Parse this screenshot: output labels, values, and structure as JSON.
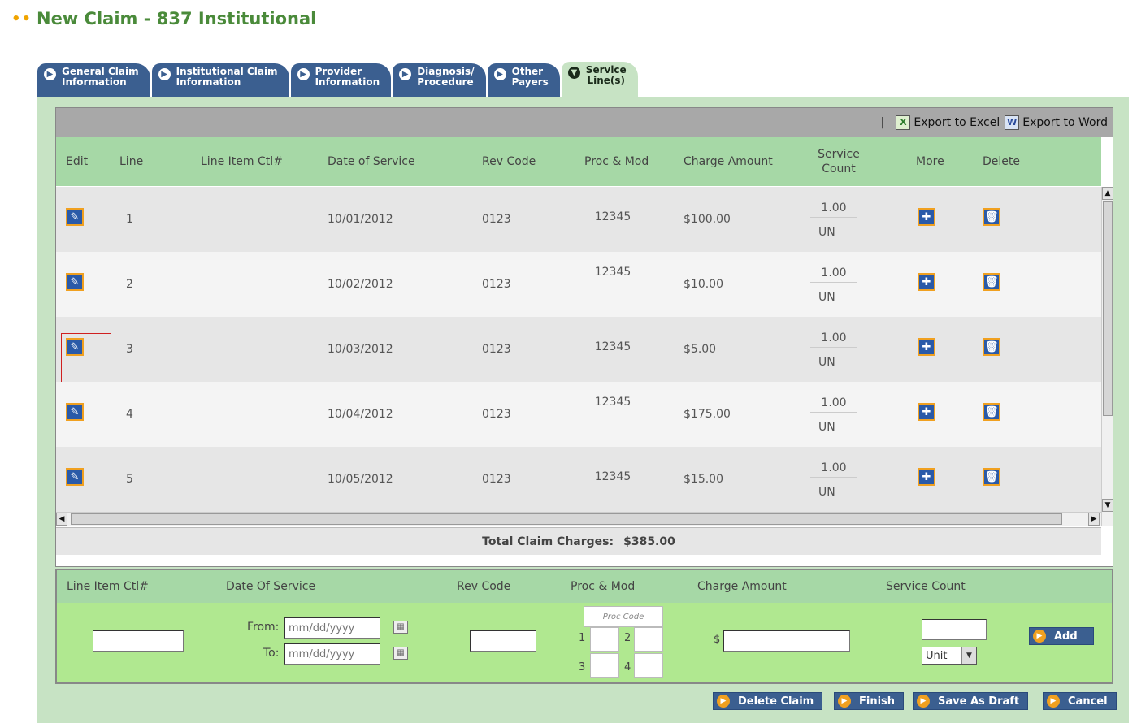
{
  "page": {
    "title": "New Claim - 837 Institutional"
  },
  "tabs": [
    {
      "label": "General Claim\nInformation",
      "active": false
    },
    {
      "label": "Institutional Claim\nInformation",
      "active": false
    },
    {
      "label": "Provider\nInformation",
      "active": false
    },
    {
      "label": "Diagnosis/\nProcedure",
      "active": false
    },
    {
      "label": "Other\nPayers",
      "active": false
    },
    {
      "label": "Service\nLine(s)",
      "active": true
    }
  ],
  "toolbar": {
    "separator": "|",
    "export_excel": "Export to Excel",
    "export_word": "Export to Word"
  },
  "grid": {
    "columns": {
      "edit": "Edit",
      "line": "Line",
      "ctl": "Line Item Ctl#",
      "date": "Date of Service",
      "rev": "Rev Code",
      "proc": "Proc & Mod",
      "charge": "Charge Amount",
      "count": "Service Count",
      "more": "More",
      "delete": "Delete"
    },
    "rows": [
      {
        "line": "1",
        "ctl": "",
        "date": "10/01/2012",
        "rev": "0123",
        "proc": "12345",
        "charge": "$100.00",
        "count": "1.00",
        "unit": "UN"
      },
      {
        "line": "2",
        "ctl": "",
        "date": "10/02/2012",
        "rev": "0123",
        "proc": "12345",
        "charge": "$10.00",
        "count": "1.00",
        "unit": "UN"
      },
      {
        "line": "3",
        "ctl": "",
        "date": "10/03/2012",
        "rev": "0123",
        "proc": "12345",
        "charge": "$5.00",
        "count": "1.00",
        "unit": "UN"
      },
      {
        "line": "4",
        "ctl": "",
        "date": "10/04/2012",
        "rev": "0123",
        "proc": "12345",
        "charge": "$175.00",
        "count": "1.00",
        "unit": "UN"
      },
      {
        "line": "5",
        "ctl": "",
        "date": "10/05/2012",
        "rev": "0123",
        "proc": "12345",
        "charge": "$15.00",
        "count": "1.00",
        "unit": "UN"
      }
    ],
    "total_label": "Total Claim Charges:",
    "total_value": "$385.00"
  },
  "entry": {
    "columns": {
      "ctl": "Line Item Ctl#",
      "date": "Date Of Service",
      "rev": "Rev Code",
      "proc": "Proc & Mod",
      "charge": "Charge Amount",
      "count": "Service Count"
    },
    "from_label": "From:",
    "to_label": "To:",
    "date_placeholder": "mm/dd/yyyy",
    "proc_placeholder": "Proc Code",
    "mod_labels": [
      "1",
      "2",
      "3",
      "4"
    ],
    "dollar": "$",
    "unit_selected": "Unit",
    "add_label": "Add"
  },
  "actions": {
    "delete_claim": "Delete Claim",
    "finish": "Finish",
    "save_draft": "Save As Draft",
    "cancel": "Cancel"
  },
  "colors": {
    "title_green": "#4a8a3a",
    "tab_blue": "#3b5f90",
    "panel_green": "#c7e3c4",
    "header_green": "#a6d8a6",
    "entry_green": "#b0e890",
    "icon_orange": "#f0a020"
  }
}
